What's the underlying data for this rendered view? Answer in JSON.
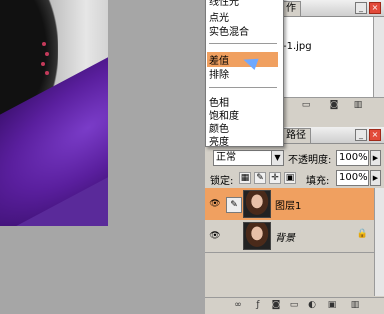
{
  "history_panel": {
    "tab_label": "作",
    "item_label": "-1.jpg"
  },
  "blend_menu": {
    "items": [
      "线性光",
      "点光",
      "实色混合",
      "差值",
      "排除",
      "色相",
      "饱和度",
      "颜色",
      "亮度"
    ],
    "selected": "差值"
  },
  "layers_panel": {
    "tab_label": "路径",
    "blend_mode": "正常",
    "opacity_label": "不透明度:",
    "opacity_value": "100%",
    "lock_label": "锁定:",
    "fill_label": "填充:",
    "fill_value": "100%",
    "layers": [
      {
        "name": "图层1",
        "selected": true,
        "italic": false
      },
      {
        "name": "背景",
        "selected": false,
        "italic": true
      }
    ]
  },
  "colors": {
    "selection": "#f0a060",
    "panel_bg": "#d4d0c8",
    "workspace": "#a6a6a6",
    "dress": "#5a1f9e"
  }
}
